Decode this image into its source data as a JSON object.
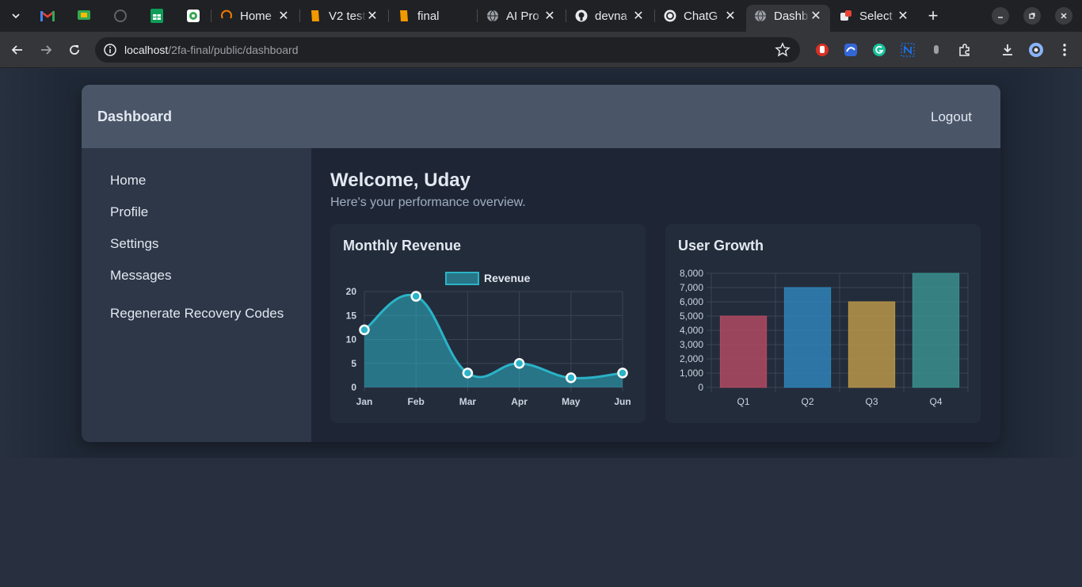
{
  "browser": {
    "tabs": [
      {
        "title": "Home",
        "icon": "loading-ring-icon"
      },
      {
        "title": "V2 test",
        "icon": "document-icon"
      },
      {
        "title": "final",
        "icon": "document-icon"
      },
      {
        "title": "AI Pro",
        "icon": "globe-icon"
      },
      {
        "title": "devna",
        "icon": "github-icon"
      },
      {
        "title": "ChatG",
        "icon": "chatgpt-icon"
      },
      {
        "title": "Dashb",
        "icon": "globe-icon",
        "active": true
      },
      {
        "title": "Select",
        "icon": "extension-icon"
      }
    ],
    "url_host": "localhost",
    "url_path": "/2fa-final/public/dashboard"
  },
  "app": {
    "brand": "Dashboard",
    "logout_label": "Logout"
  },
  "sidebar": {
    "items": [
      {
        "label": "Home"
      },
      {
        "label": "Profile"
      },
      {
        "label": "Settings"
      },
      {
        "label": "Messages"
      },
      {
        "label": "Regenerate Recovery Codes"
      }
    ]
  },
  "main": {
    "welcome": "Welcome, Uday",
    "subtitle": "Here's your performance overview."
  },
  "colors": {
    "line": "#2bb3c7",
    "bars": [
      "#b04a63",
      "#2e82b8",
      "#b8964a",
      "#3a8f8f"
    ]
  },
  "chart_data": [
    {
      "type": "area",
      "title": "Monthly Revenue",
      "x": [
        "Jan",
        "Feb",
        "Mar",
        "Apr",
        "May",
        "Jun"
      ],
      "series": [
        {
          "name": "Revenue",
          "values": [
            12,
            19,
            3,
            5,
            2,
            3
          ]
        }
      ],
      "ylim": [
        0,
        20
      ],
      "yticks": [
        "0",
        "5",
        "10",
        "15",
        "20"
      ],
      "legend": "top",
      "grid": true
    },
    {
      "type": "bar",
      "title": "User Growth",
      "categories": [
        "Q1",
        "Q2",
        "Q3",
        "Q4"
      ],
      "values": [
        5000,
        7000,
        6000,
        8000
      ],
      "ylim": [
        0,
        8000
      ],
      "yticks": [
        "0",
        "1,000",
        "2,000",
        "3,000",
        "4,000",
        "5,000",
        "6,000",
        "7,000",
        "8,000"
      ],
      "grid": true
    }
  ]
}
